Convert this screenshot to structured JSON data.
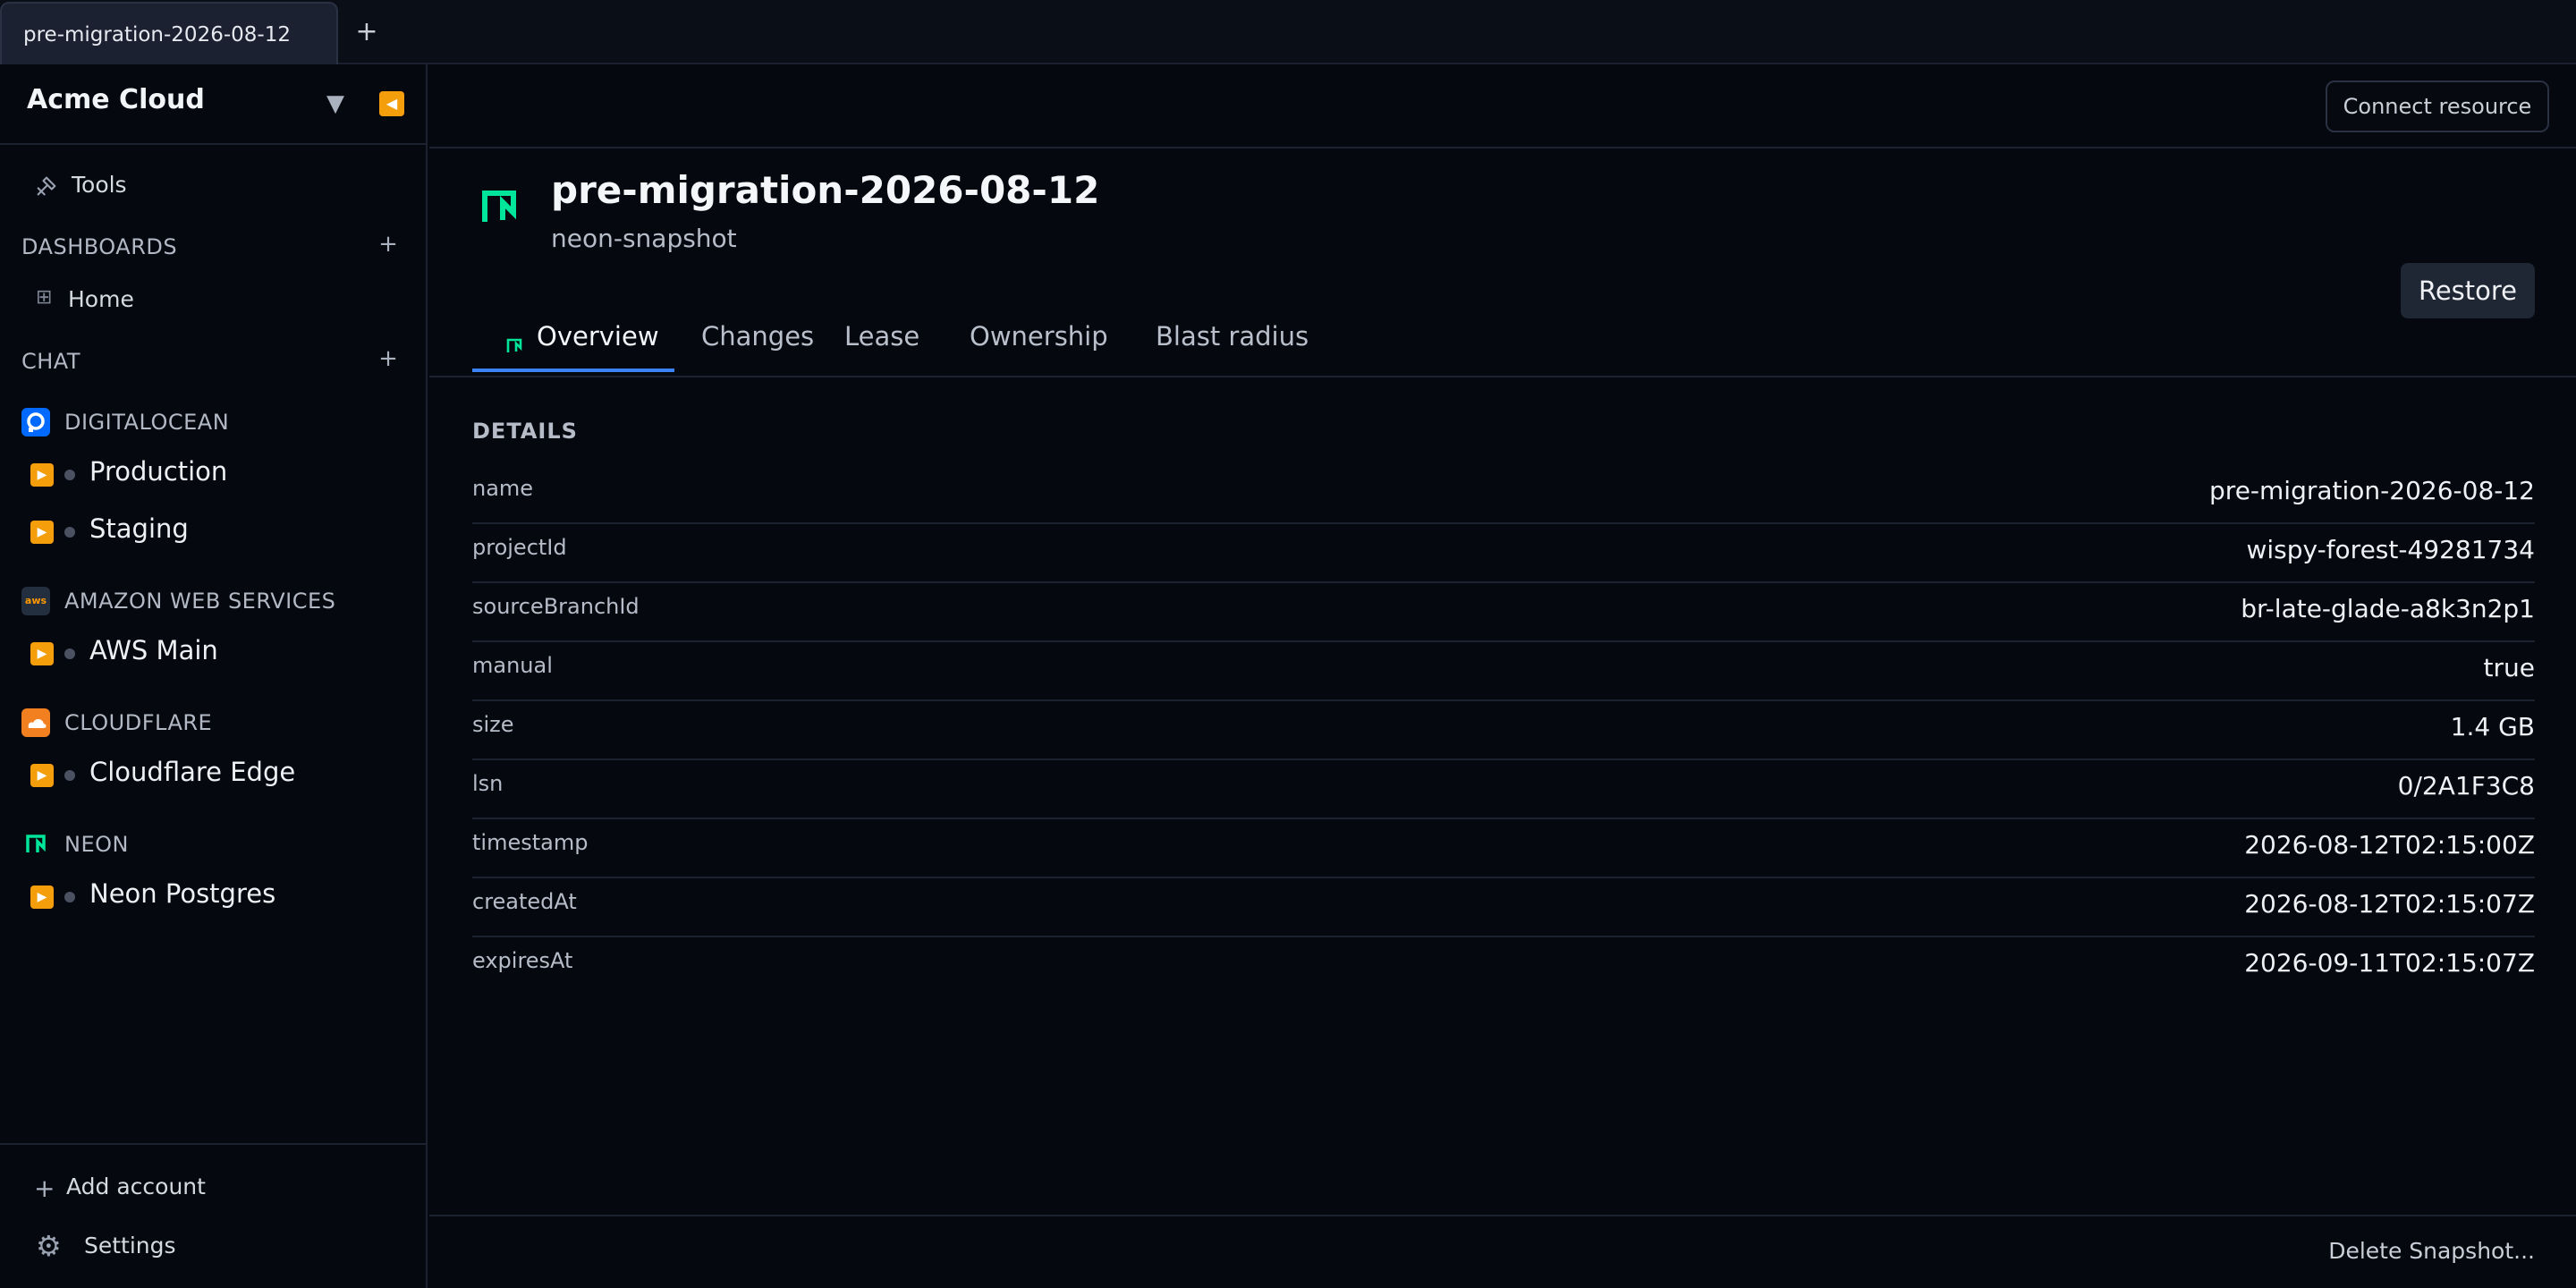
{
  "tabstrip": {
    "active_tab": "pre-migration-2026-08-12",
    "new_tab": "+"
  },
  "sidebar": {
    "org_name": "Acme Cloud",
    "dropdown_glyph": "▼",
    "collapse_glyph": "◀",
    "tools_label": "Tools",
    "dashboards_label": "DASHBOARDS",
    "add_glyph": "+",
    "home_label": "Home",
    "chat_label": "CHAT",
    "providers": [
      {
        "name": "DIGITALOCEAN",
        "icon": "digitalocean-icon",
        "color": "#0069ff",
        "resources": [
          "Production",
          "Staging"
        ]
      },
      {
        "name": "AMAZON WEB SERVICES",
        "icon": "aws-icon",
        "color": "#232f3e",
        "resources": [
          "AWS Main"
        ]
      },
      {
        "name": "CLOUDFLARE",
        "icon": "cloudflare-icon",
        "color": "#f38020",
        "resources": [
          "Cloudflare Edge"
        ]
      },
      {
        "name": "NEON",
        "icon": "neon-icon",
        "color": "#00e599",
        "resources": [
          "Neon Postgres"
        ]
      }
    ],
    "aws_icon_text": "aws",
    "add_account_label": "Add account",
    "settings_label": "Settings"
  },
  "main": {
    "connect_label": "Connect resource",
    "title": "pre-migration-2026-08-12",
    "type": "neon-snapshot",
    "restore_label": "Restore",
    "tabs": [
      "Overview",
      "Changes",
      "Lease",
      "Ownership",
      "Blast radius"
    ],
    "details_title": "DETAILS",
    "details": [
      {
        "key": "name",
        "value": "pre-migration-2026-08-12"
      },
      {
        "key": "projectId",
        "value": "wispy-forest-49281734"
      },
      {
        "key": "sourceBranchId",
        "value": "br-late-glade-a8k3n2p1"
      },
      {
        "key": "manual",
        "value": "true"
      },
      {
        "key": "size",
        "value": "1.4 GB"
      },
      {
        "key": "lsn",
        "value": "0/2A1F3C8"
      },
      {
        "key": "timestamp",
        "value": "2026-08-12T02:15:00Z"
      },
      {
        "key": "createdAt",
        "value": "2026-08-12T02:15:07Z"
      },
      {
        "key": "expiresAt",
        "value": "2026-09-11T02:15:07Z"
      }
    ],
    "delete_label": "Delete Snapshot..."
  },
  "colors": {
    "accent": "#3b82f6",
    "neon": "#00e599",
    "play": "#f59e0b"
  }
}
